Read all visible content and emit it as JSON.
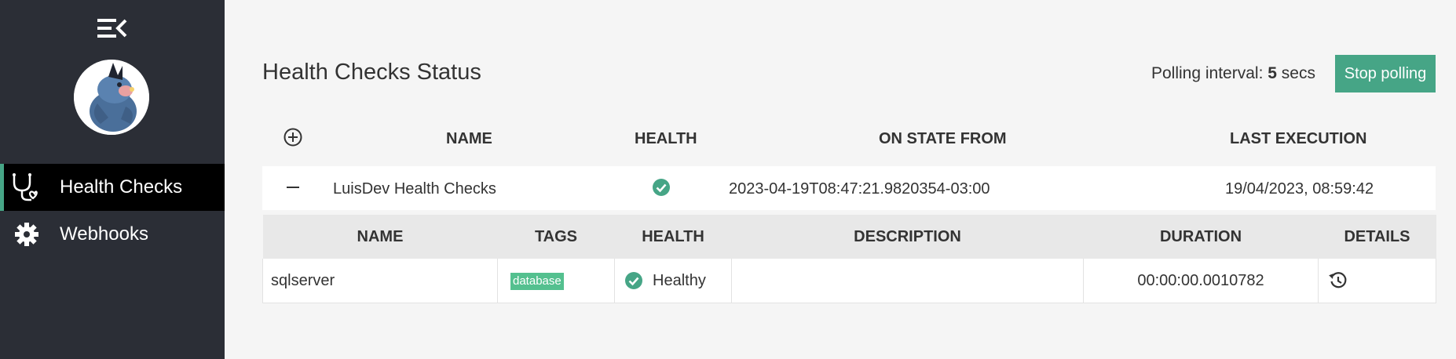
{
  "sidebar": {
    "items": [
      {
        "label": "Health Checks",
        "icon": "stethoscope-icon",
        "active": true
      },
      {
        "label": "Webhooks",
        "icon": "gear-icon",
        "active": false
      }
    ]
  },
  "header": {
    "title": "Health Checks Status",
    "polling_prefix": "Polling interval:",
    "polling_value": "5",
    "polling_unit": "secs",
    "stop_button": "Stop polling"
  },
  "outer_table": {
    "columns": [
      "NAME",
      "HEALTH",
      "ON STATE FROM",
      "LAST EXECUTION"
    ],
    "rows": [
      {
        "name": "LuisDev Health Checks",
        "health": "healthy",
        "on_state_from": "2023-04-19T08:47:21.9820354-03:00",
        "last_execution": "19/04/2023, 08:59:42"
      }
    ]
  },
  "inner_table": {
    "columns": [
      "NAME",
      "TAGS",
      "HEALTH",
      "DESCRIPTION",
      "DURATION",
      "DETAILS"
    ],
    "rows": [
      {
        "name": "sqlserver",
        "tag": "database",
        "health": "Healthy",
        "description": "",
        "duration": "00:00:00.0010782"
      }
    ]
  },
  "colors": {
    "accent": "#46a586",
    "sidebar": "#2b2e36",
    "tag": "#54c08f"
  }
}
